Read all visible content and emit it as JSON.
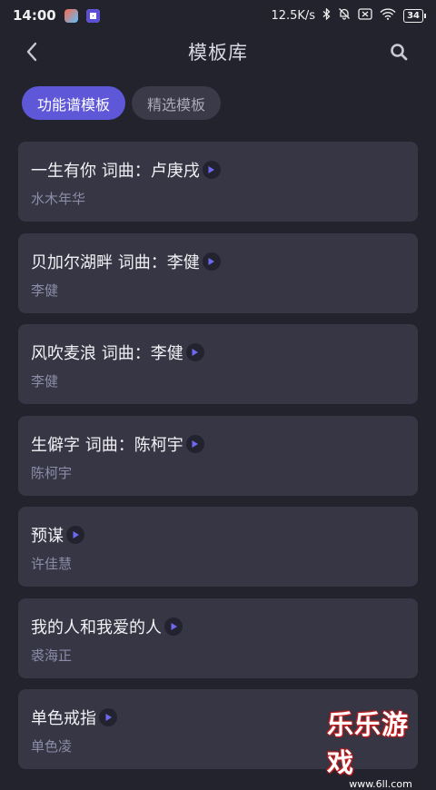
{
  "status_bar": {
    "time": "14:00",
    "net_speed": "12.5K/s",
    "battery": "34"
  },
  "header": {
    "title": "模板库",
    "back_icon": "back-arrow-icon",
    "search_icon": "search-icon"
  },
  "tabs": [
    {
      "label": "功能谱模板",
      "active": true
    },
    {
      "label": "精选模板",
      "active": false
    }
  ],
  "templates": [
    {
      "title": "一生有你 词曲：卢庚戌",
      "author": "水木年华"
    },
    {
      "title": "贝加尔湖畔 词曲：李健",
      "author": "李健"
    },
    {
      "title": "风吹麦浪 词曲：李健",
      "author": "李健"
    },
    {
      "title": "生僻字 词曲：陈柯宇",
      "author": "陈柯宇"
    },
    {
      "title": "预谋",
      "author": "许佳慧"
    },
    {
      "title": "我的人和我爱的人",
      "author": "裘海正"
    },
    {
      "title": "单色戒指",
      "author": "单色凌"
    }
  ],
  "watermark": {
    "text": "乐乐游戏",
    "url": "www.6ll.com"
  },
  "colors": {
    "background": "#23232e",
    "card": "#363644",
    "accent": "#5e57d8",
    "play_icon": "#6f68f0"
  }
}
